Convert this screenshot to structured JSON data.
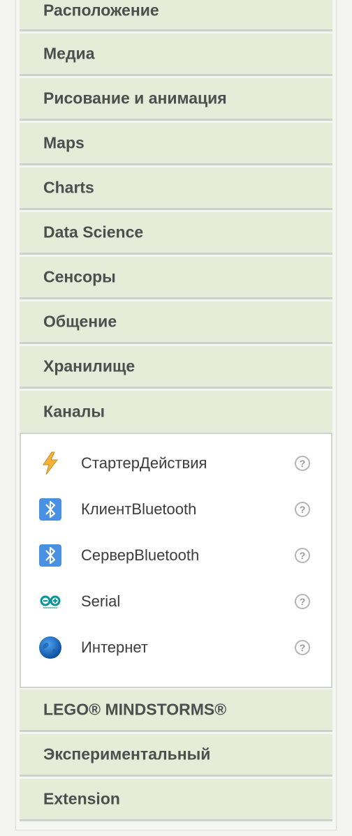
{
  "palette": {
    "categories_top": [
      {
        "label": "Расположение"
      },
      {
        "label": "Медиа"
      },
      {
        "label": "Рисование и анимация"
      },
      {
        "label": "Maps"
      },
      {
        "label": "Charts"
      },
      {
        "label": "Data Science"
      },
      {
        "label": "Сенсоры"
      },
      {
        "label": "Общение"
      },
      {
        "label": "Хранилище"
      },
      {
        "label": "Каналы"
      }
    ],
    "open_category": {
      "label": "Каналы",
      "components": [
        {
          "label": "СтартерДействия",
          "icon": "lightning-bolt-icon"
        },
        {
          "label": "КлиентBluetooth",
          "icon": "bluetooth-icon"
        },
        {
          "label": "СерверBluetooth",
          "icon": "bluetooth-icon"
        },
        {
          "label": "Serial",
          "icon": "arduino-icon"
        },
        {
          "label": "Интернет",
          "icon": "globe-icon"
        }
      ]
    },
    "categories_bottom": [
      {
        "label": "LEGO® MINDSTORMS®"
      },
      {
        "label": "Экспериментальный"
      },
      {
        "label": "Extension"
      }
    ]
  },
  "colors": {
    "drawer_bg": "#e7ecd9",
    "drawer_text": "#4e4e4e",
    "panel_bg": "#f6f6f3",
    "bluetooth_bg": "#4a90e2",
    "lightning": "#f3b23a",
    "globe": "#1c6fc5",
    "arduino": "#00979c"
  }
}
